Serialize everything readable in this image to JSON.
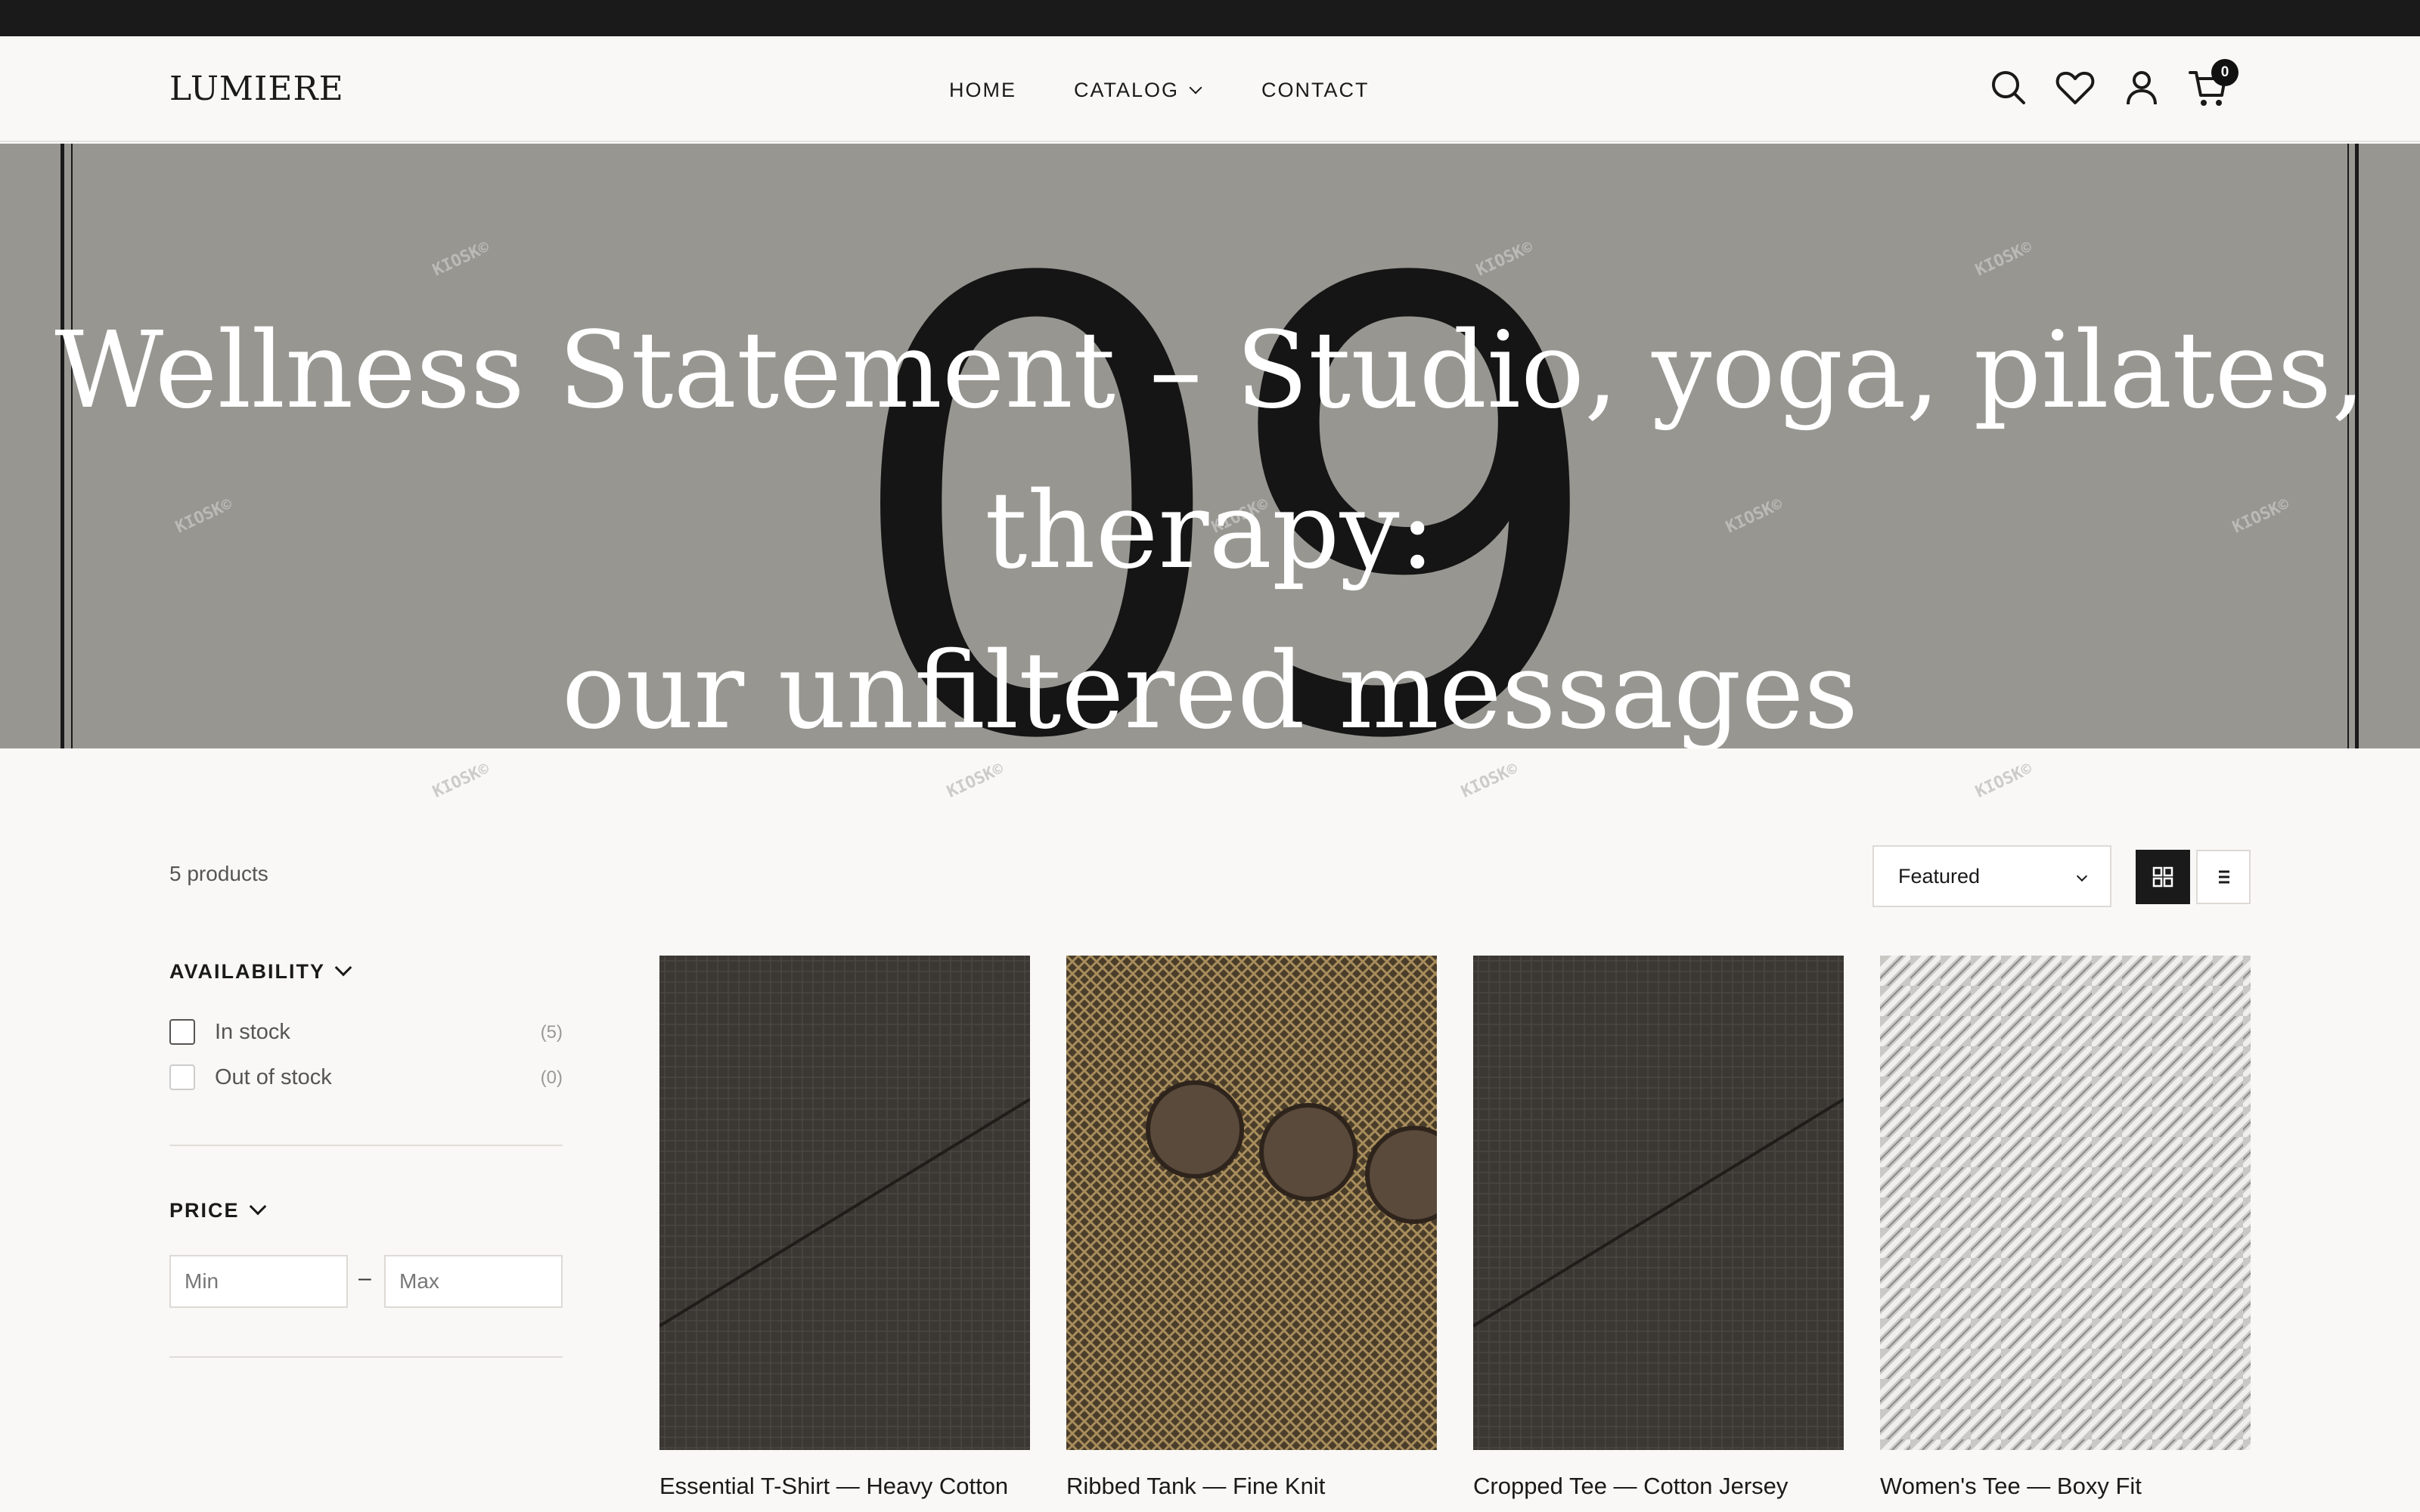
{
  "header": {
    "logo": "LUMIERE",
    "nav": {
      "home": "HOME",
      "catalog": "CATALOG",
      "contact": "CONTACT"
    },
    "cart_count": "0",
    "icons": [
      "search-icon",
      "heart-icon",
      "account-icon",
      "cart-icon"
    ]
  },
  "hero": {
    "title_line1": "Wellness Statement – Studio, yoga, pilates, therapy:",
    "title_line2": "our unfiltered messages",
    "background_number": "09",
    "watermark": "KIOSK©"
  },
  "toolbar": {
    "product_count": "5 products",
    "sort_selected": "Featured"
  },
  "filters": {
    "availability": {
      "title": "AVAILABILITY",
      "options": [
        {
          "label": "In stock",
          "count": "(5)"
        },
        {
          "label": "Out of stock",
          "count": "(0)"
        }
      ]
    },
    "price": {
      "title": "PRICE",
      "min_placeholder": "Min",
      "max_placeholder": "Max",
      "separator": "–"
    }
  },
  "products": [
    {
      "title": "Essential T-Shirt — Heavy Cotton"
    },
    {
      "title": "Ribbed Tank — Fine Knit"
    },
    {
      "title": "Cropped Tee — Cotton Jersey"
    },
    {
      "title": "Women's Tee — Boxy Fit"
    }
  ],
  "colors": {
    "topbar": "#1a1a1a",
    "background": "#f9f8f6",
    "hero_bg": "#979691",
    "text": "#1a1a1a"
  }
}
